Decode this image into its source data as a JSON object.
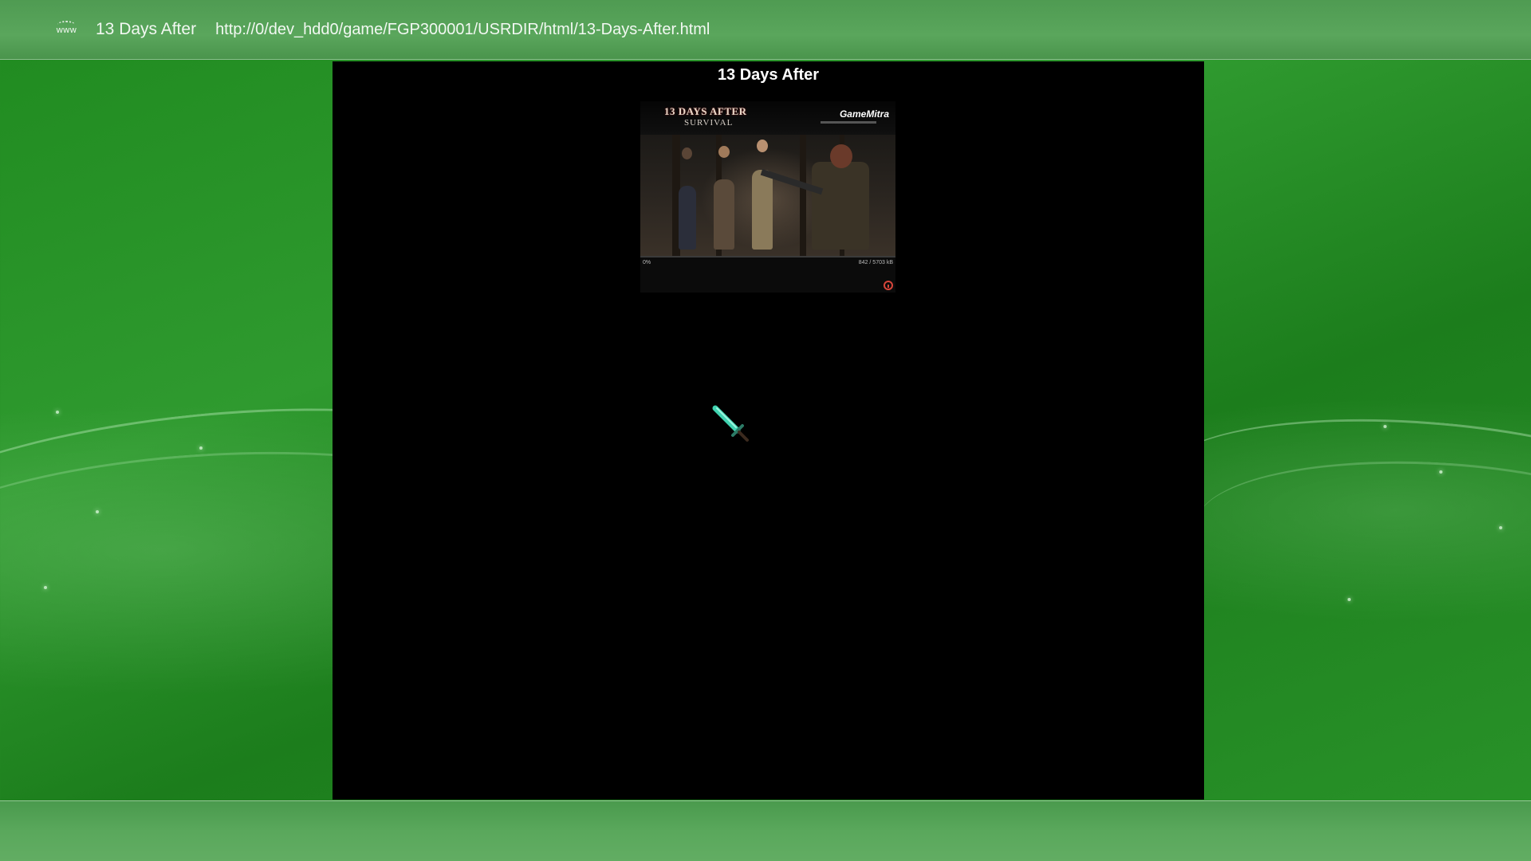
{
  "browser": {
    "tab_title": "13 Days After",
    "url": "http://0/dev_hdd0/game/FGP300001/USRDIR/html/13-Days-After.html",
    "icon": "www-globe-icon",
    "icon_label": "www"
  },
  "page": {
    "heading": "13 Days After"
  },
  "game_embed": {
    "title_line1": "13 DAYS AFTER",
    "title_line2": "SURVIVAL",
    "brand": "GameMitra",
    "load_progress_fraction": 0.0,
    "progress_left": "0%",
    "progress_right": "842 / 5703 kB",
    "reload_icon": "reload-icon"
  },
  "cursor": {
    "icon": "sword-cursor-icon"
  },
  "colors": {
    "background_green": "#2a942a",
    "bar_green": "#55a157",
    "content_bg": "#000000",
    "progress_red": "#d9252a",
    "cursor_teal": "#3fd3b0"
  }
}
